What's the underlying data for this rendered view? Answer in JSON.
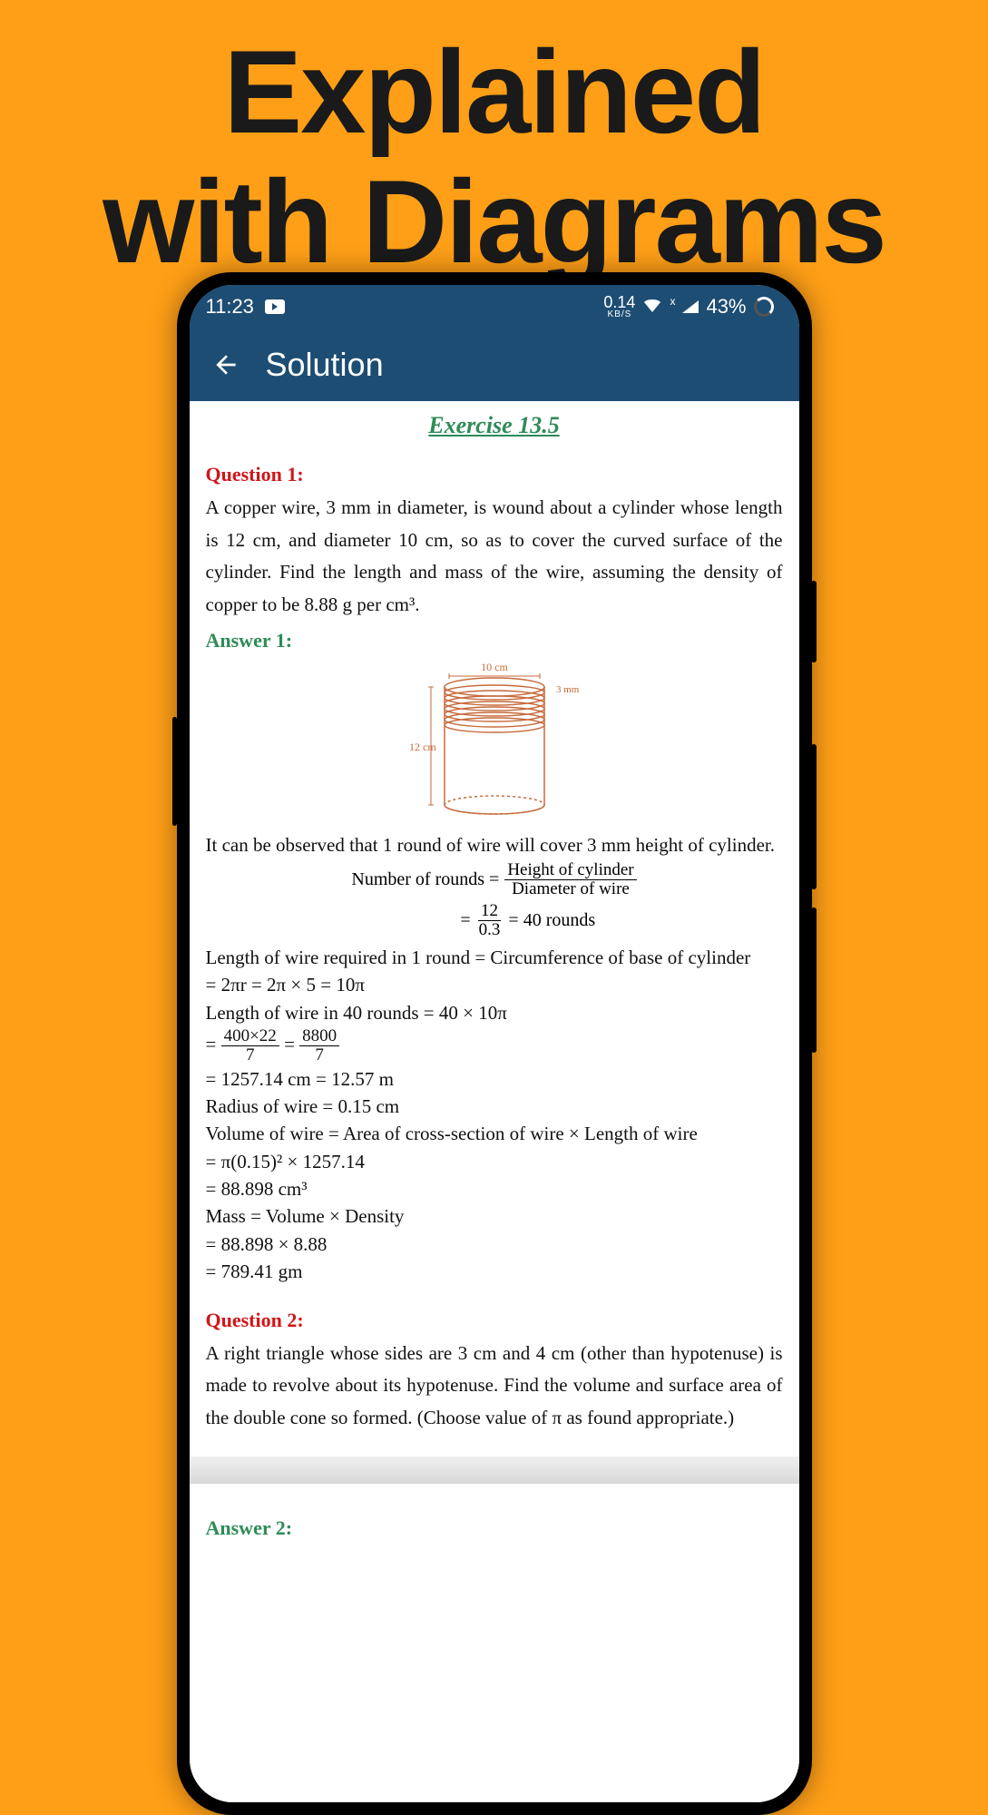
{
  "promo": {
    "line1": "Explained",
    "line2": "with Diagrams"
  },
  "statusbar": {
    "time": "11:23",
    "data_rate_value": "0.14",
    "data_rate_unit": "KB/S",
    "signal_note": "x",
    "battery": "43%"
  },
  "appbar": {
    "title": "Solution"
  },
  "page": {
    "exercise_title": "Exercise 13.5",
    "q1": {
      "label": "Question 1:",
      "text": "A copper wire, 3 mm in diameter, is wound about a cylinder whose length is 12 cm, and diameter 10 cm, so as to cover the curved surface of the cylinder. Find the length and mass of the wire, assuming the density of copper to be 8.88 g per cm³.",
      "answer_label": "Answer 1:",
      "diagram": {
        "top_label": "10 cm",
        "side_label": "12 cm",
        "wire_label": "3 mm"
      },
      "obs": "It can be observed that 1 round of wire will cover 3 mm height of cylinder.",
      "rounds": {
        "lead": "Number of rounds =",
        "num1": "Height of cylinder",
        "den1": "Diameter of wire",
        "num2": "12",
        "den2": "0.3",
        "eq": "= 40 rounds"
      },
      "lines": [
        "Length of wire required in 1 round = Circumference of base of cylinder",
        "= 2πr = 2π × 5 = 10π",
        "Length of wire in 40 rounds = 40 × 10π"
      ],
      "frac2": {
        "n1": "400×22",
        "d1": "7",
        "n2": "8800",
        "d2": "7"
      },
      "lines2": [
        "= 1257.14 cm = 12.57 m",
        "Radius of wire = 0.15 cm",
        "Volume of wire = Area of cross-section of wire × Length of wire",
        "= π(0.15)² × 1257.14",
        "= 88.898 cm³",
        "Mass = Volume × Density",
        "= 88.898 × 8.88",
        "= 789.41 gm"
      ]
    },
    "q2": {
      "label": "Question 2:",
      "text": "A right triangle whose sides are 3 cm and 4 cm (other than hypotenuse) is made to revolve about its hypotenuse. Find the volume and surface area of the double cone so formed. (Choose value of π as found appropriate.)",
      "answer_label": "Answer 2:"
    }
  }
}
